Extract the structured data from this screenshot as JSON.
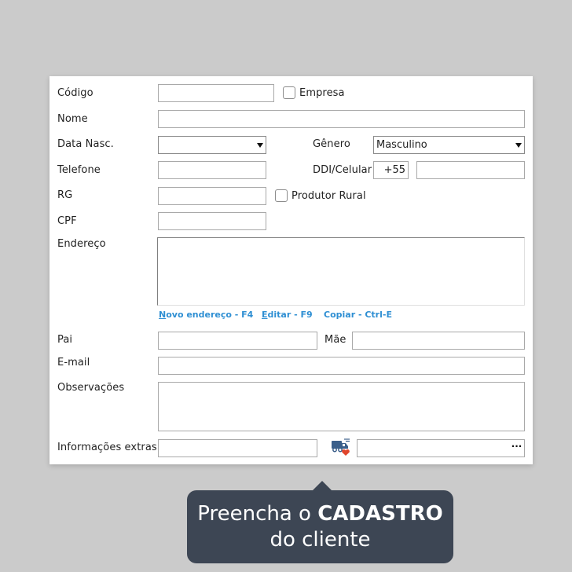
{
  "form": {
    "codigo_label": "Código",
    "empresa_label": "Empresa",
    "nome_label": "Nome",
    "data_nasc_label": "Data Nasc.",
    "genero_label": "Gênero",
    "genero_value": "Masculino",
    "telefone_label": "Telefone",
    "ddi_label": "DDI/Celular",
    "ddi_value": "+55",
    "rg_label": "RG",
    "produtor_label": "Produtor Rural",
    "cpf_label": "CPF",
    "endereco_label": "Endereço",
    "links": {
      "novo_key": "N",
      "novo_rest": "ovo endereço - F4",
      "editar_key": "E",
      "editar_rest": "ditar - F9",
      "copiar": "Copiar - Ctrl-E"
    },
    "pai_label": "Pai",
    "mae_label": "Mãe",
    "email_label": "E-mail",
    "observacoes_label": "Observações",
    "info_label": "Informações extras",
    "ellipsis": "···"
  },
  "tooltip": {
    "line1_regular": "Preencha o ",
    "line1_bold": "CADASTRO",
    "line2": "do cliente"
  },
  "icons": {
    "delivery_truck": "truck-heart-icon"
  },
  "colors": {
    "link": "#2f8fd3",
    "tooltip_bg": "#3d4654",
    "page_bg": "#cbcbcb",
    "heart": "#e0452c",
    "truck": "#3b5f8a"
  }
}
